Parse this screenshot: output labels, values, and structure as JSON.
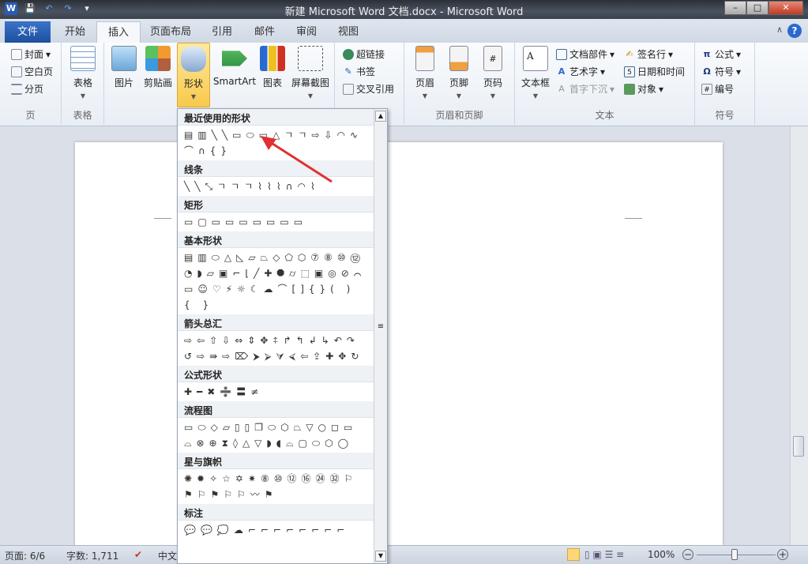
{
  "window": {
    "title": "新建 Microsoft Word 文档.docx - Microsoft Word",
    "min": "–",
    "max": "□",
    "close": "✕"
  },
  "quick_access": {
    "logo": "W",
    "save": "💾",
    "undo": "↶",
    "redo": "↷",
    "customize": "▾"
  },
  "tabs": [
    {
      "label": "文件"
    },
    {
      "label": "开始"
    },
    {
      "label": "插入"
    },
    {
      "label": "页面布局"
    },
    {
      "label": "引用"
    },
    {
      "label": "邮件"
    },
    {
      "label": "审阅"
    },
    {
      "label": "视图"
    }
  ],
  "help": "?",
  "minimize_ribbon": "∧",
  "ribbon": {
    "page_group": {
      "label": "页",
      "cover": "封面",
      "blank": "空白页",
      "break": "分页"
    },
    "table_group": {
      "label": "表格",
      "table": "表格"
    },
    "illus": {
      "picture": "图片",
      "clipart": "剪贴画",
      "shapes": "形状",
      "smartart": "SmartArt",
      "chart": "图表",
      "screenshot": "屏幕截图"
    },
    "links": {
      "hyperlink": "超链接",
      "bookmark": "书签",
      "crossref": "交叉引用"
    },
    "header_footer": {
      "label": "页眉和页脚",
      "header": "页眉",
      "footer": "页脚",
      "pagenum": "页码"
    },
    "text": {
      "label": "文本",
      "textbox": "文本框",
      "quickparts": "文档部件",
      "wordart": "艺术字",
      "dropcap": "首字下沉",
      "sigline": "签名行",
      "datetime": "日期和时间",
      "object": "对象"
    },
    "symbols": {
      "label": "符号",
      "equation": "公式",
      "symbol": "符号",
      "number": "编号"
    }
  },
  "gallery": {
    "categories": [
      {
        "name": "最近使用的形状",
        "shapes": "▤▥╲╲▭⬭▭△ㄱㄱ⇨⇩◠∿⌒∩{}"
      },
      {
        "name": "线条",
        "shapes": "╲╲⤡ㄱㄱㄱ⌇⌇⌇∩◠⌇"
      },
      {
        "name": "矩形",
        "shapes": "▭▢▭▭▭▭▭▭▭"
      },
      {
        "name": "基本形状",
        "shapes": "▤▥⬭△◺▱⏢◇⬠⬡⑦⑧⑩⑫◔◗▱▣⌐⌊╱✚⯃⌭⬚▣◎⊘⌒▭☺♡⚡☼☾☁⌒[]{}( ) { }"
      },
      {
        "name": "箭头总汇",
        "shapes": "⇨⇦⇧⇩⇔⇕✥⍏↱↰↲↳↶↷↺⇨⇛⇨⌦⮞⮚⮛⮘⇦⇪✚✥↻"
      },
      {
        "name": "公式形状",
        "shapes": "✚━✖➗〓≠"
      },
      {
        "name": "流程图",
        "shapes": "▭⬭◇▱▯▯❐⬭⬡⏢▽○◻▭⌓⊗⊕⧗◊△▽◗◖⌓▢⬭⬡◯"
      },
      {
        "name": "星与旗帜",
        "shapes": "✺✹✧☆✡✷⑧⑩⑫⑯㉔㉜⚐⚑⚐⚑⚐⚐〰⚑"
      },
      {
        "name": "标注",
        "shapes": "💬💬💭☁⌐⌐⌐⌐⌐⌐⌐⌐"
      }
    ],
    "up": "▲",
    "down": "▼",
    "grip": "≡"
  },
  "status": {
    "page": "页面: 6/6",
    "words": "字数: 1,711",
    "lang": "中文",
    "zoom": "100%",
    "zoom_out": "−",
    "zoom_in": "+"
  },
  "zoom_level_percent": 100,
  "colors": {
    "accent": "#f8c94a",
    "file_tab": "#2a5ab8",
    "arrow": "#e03030"
  }
}
